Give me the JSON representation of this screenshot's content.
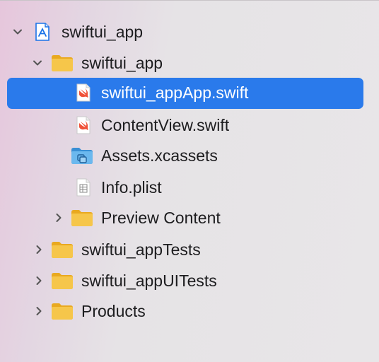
{
  "tree": {
    "items": [
      {
        "label": "swiftui_app",
        "icon": "xcode-project-icon",
        "chevron": "down"
      },
      {
        "label": "swiftui_app",
        "icon": "folder-icon",
        "chevron": "down"
      },
      {
        "label": "swiftui_appApp.swift",
        "icon": "swift-file-icon",
        "chevron": "",
        "selected": true
      },
      {
        "label": "ContentView.swift",
        "icon": "swift-file-icon",
        "chevron": ""
      },
      {
        "label": "Assets.xcassets",
        "icon": "asset-catalog-icon",
        "chevron": ""
      },
      {
        "label": "Info.plist",
        "icon": "plist-file-icon",
        "chevron": ""
      },
      {
        "label": "Preview Content",
        "icon": "folder-icon",
        "chevron": "right"
      },
      {
        "label": "swiftui_appTests",
        "icon": "folder-icon",
        "chevron": "right"
      },
      {
        "label": "swiftui_appUITests",
        "icon": "folder-icon",
        "chevron": "right"
      },
      {
        "label": "Products",
        "icon": "folder-icon",
        "chevron": "right"
      }
    ]
  },
  "colors": {
    "selection": "#2a7aeb",
    "folder": "#f6c64a",
    "swift": "#f05138",
    "project_blue": "#1a73e8"
  }
}
